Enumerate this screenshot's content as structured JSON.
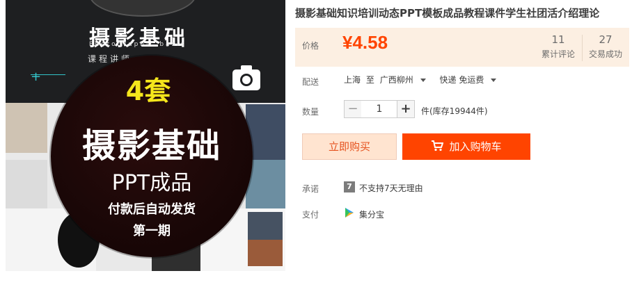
{
  "product_image": {
    "title": "摄影基础",
    "subtitle_en": "Photographic basis",
    "subtitle_cn": "课程讲师",
    "badge_count": "4套",
    "badge_main": "摄影基础",
    "badge_ppt": "PPT成品",
    "badge_shipping": "付款后自动发货",
    "badge_issue": "第一期",
    "icon": "camera-icon"
  },
  "title": "摄影基础知识培训动态PPT模板成品教程课件学生社团活介绍理论",
  "price": {
    "label": "价格",
    "value": "¥4.58",
    "reviews_count": "11",
    "reviews_label": "累计评论",
    "deals_count": "27",
    "deals_label": "交易成功",
    "panel_color": "#fcefe2",
    "price_color": "#ff4400"
  },
  "shipping": {
    "label": "配送",
    "from": "上海",
    "to_word": "至",
    "destination": "广西柳州",
    "method": "快递 免运费"
  },
  "quantity": {
    "label": "数量",
    "minus": "−",
    "value": "1",
    "plus": "+",
    "stock": "件(库存19944件)"
  },
  "actions": {
    "buy_now": "立即购买",
    "add_to_cart": "加入购物车",
    "accent_color": "#ff4400"
  },
  "promise": {
    "label": "承诺",
    "icon_text": "7",
    "text": "不支持7天无理由"
  },
  "payment": {
    "label": "支付",
    "method": "集分宝"
  }
}
